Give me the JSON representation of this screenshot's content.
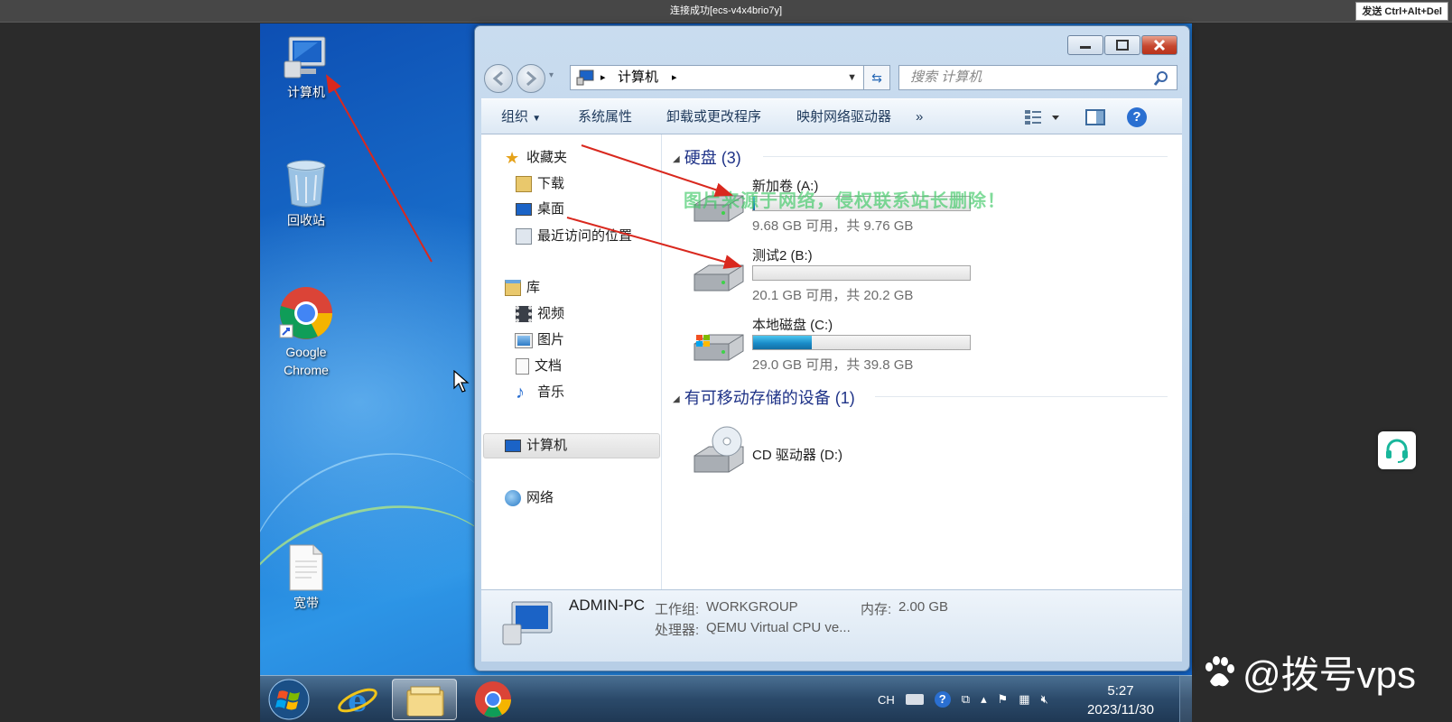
{
  "remote": {
    "title": "连接成功[ecs-v4x4brio7y]",
    "cad_button": "发送 Ctrl+Alt+Del"
  },
  "desktop": {
    "icons": [
      {
        "label": "计算机"
      },
      {
        "label": "回收站"
      },
      {
        "label_line1": "Google",
        "label_line2": "Chrome"
      },
      {
        "label": "宽带"
      }
    ]
  },
  "explorer": {
    "breadcrumb": {
      "location": "计算机",
      "arrow1": "▸",
      "arrow2": "▸"
    },
    "search_placeholder": "搜索 计算机",
    "toolbar": {
      "organize": "组织",
      "system_properties": "系统属性",
      "uninstall": "卸载或更改程序",
      "map_drive": "映射网络驱动器",
      "more": "»"
    },
    "nav": {
      "favorites": "收藏夹",
      "downloads": "下载",
      "desktop": "桌面",
      "recent": "最近访问的位置",
      "libraries": "库",
      "videos": "视频",
      "pictures": "图片",
      "documents": "文档",
      "music": "音乐",
      "computer": "计算机",
      "network": "网络"
    },
    "groups": {
      "hard_disks": "硬盘 (3)",
      "removable": "有可移动存储的设备 (1)"
    },
    "drives": [
      {
        "name": "新加卷 (A:)",
        "info": "9.68 GB 可用，共 9.76 GB",
        "used_fraction": 0.01
      },
      {
        "name": "测试2 (B:)",
        "info": "20.1 GB 可用，共 20.2 GB",
        "used_fraction": 0.0
      },
      {
        "name": "本地磁盘 (C:)",
        "info": "29.0 GB 可用，共 39.8 GB",
        "used_fraction": 0.27
      }
    ],
    "cd_drive": "CD 驱动器 (D:)",
    "details": {
      "pc_name": "ADMIN-PC",
      "workgroup_label": "工作组:",
      "workgroup": "WORKGROUP",
      "memory_label": "内存:",
      "memory": "2.00 GB",
      "cpu_label": "处理器:",
      "cpu": "QEMU Virtual CPU ve..."
    }
  },
  "taskbar": {
    "lang": "CH",
    "time": "5:27",
    "date": "2023/11/30"
  },
  "overlay": {
    "watermark": "图片来源于网络，侵权联系站长删除！",
    "brand": "@拨号vps"
  },
  "colors": {
    "desktop": "#1f7fd8",
    "group_title": "#1e3287",
    "bar_fill": "#1a8cc9",
    "close_button": "#c6472f"
  }
}
